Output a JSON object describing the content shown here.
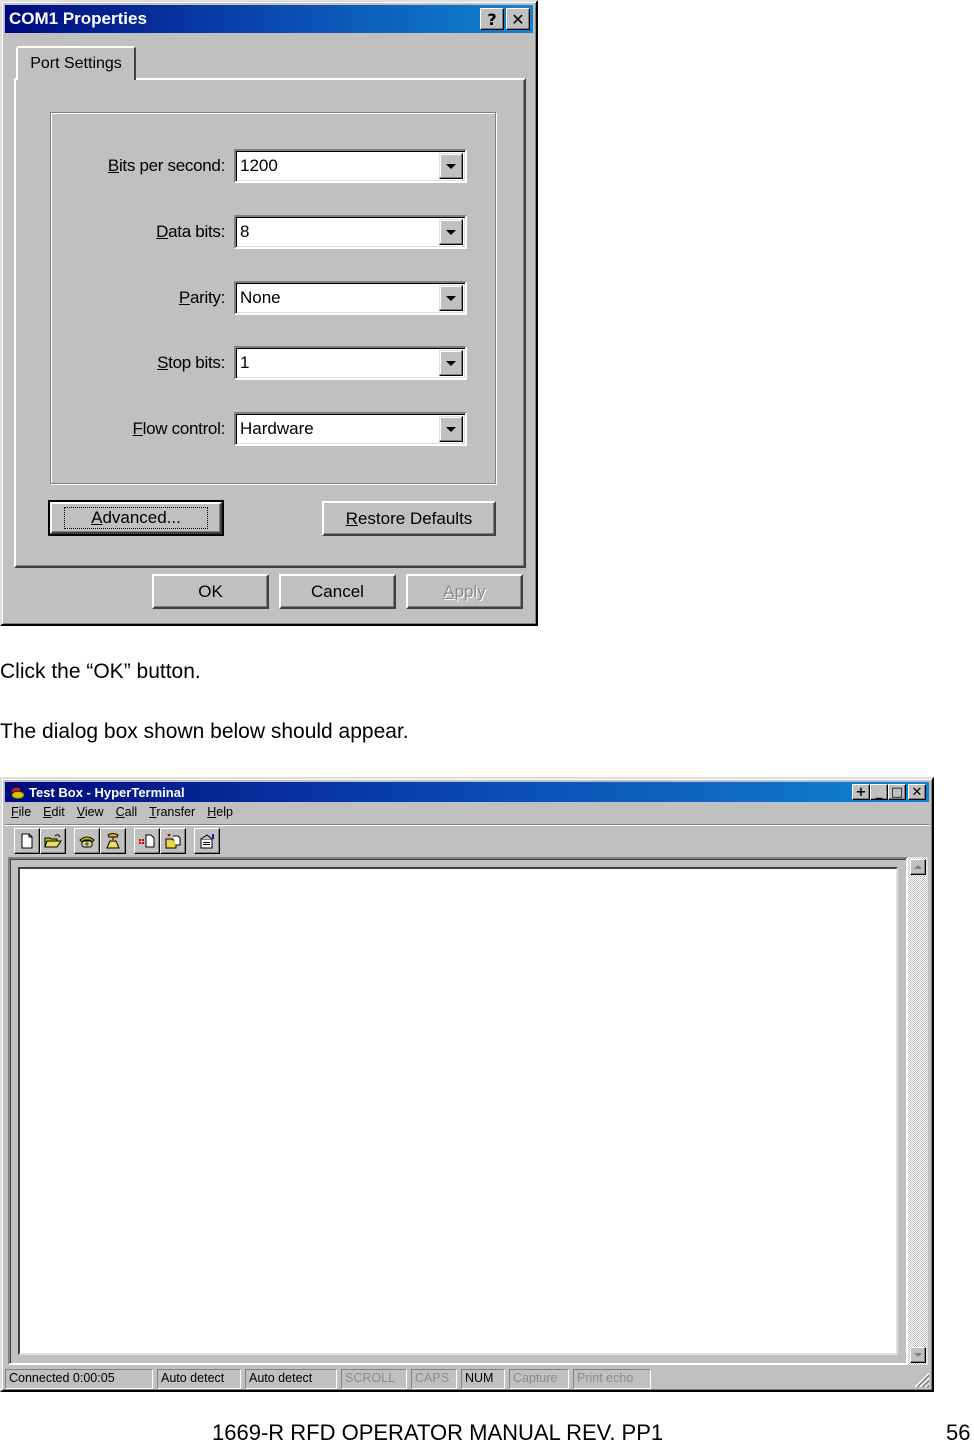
{
  "com1_dialog": {
    "title": "COM1 Properties",
    "help_button": "?",
    "close_button": "✕",
    "tab": "Port Settings",
    "fields": [
      {
        "label_mnemonic": "B",
        "label_rest": "its per second:",
        "value": "1200"
      },
      {
        "label_mnemonic": "D",
        "label_rest": "ata bits:",
        "value": "8"
      },
      {
        "label_mnemonic": "P",
        "label_rest": "arity:",
        "value": "None"
      },
      {
        "label_mnemonic": "S",
        "label_rest": "top bits:",
        "value": "1"
      },
      {
        "label_mnemonic": "F",
        "label_rest": "low control:",
        "value": "Hardware"
      }
    ],
    "advanced_button": {
      "mnemonic": "A",
      "rest": "dvanced..."
    },
    "restore_button": {
      "mnemonic": "R",
      "rest": "estore Defaults"
    },
    "ok_button": "OK",
    "cancel_button": "Cancel",
    "apply_button": {
      "mnemonic": "A",
      "rest": "pply"
    }
  },
  "instructions": {
    "step1": "Click the “OK” button.",
    "step2": "The dialog box shown below should appear."
  },
  "hyperterminal": {
    "title": "Test Box - HyperTerminal",
    "window_buttons": {
      "pin": "+",
      "minimize": "_",
      "maximize": "□",
      "close": "✕"
    },
    "menu": [
      {
        "mnemonic": "F",
        "rest": "ile"
      },
      {
        "mnemonic": "E",
        "rest": "dit"
      },
      {
        "mnemonic": "V",
        "rest": "iew"
      },
      {
        "mnemonic": "C",
        "rest": "all"
      },
      {
        "mnemonic": "T",
        "rest": "ransfer"
      },
      {
        "mnemonic": "H",
        "rest": "elp"
      }
    ],
    "toolbar": [
      "new-icon",
      "open-icon",
      "connect-icon",
      "disconnect-icon",
      "send-icon",
      "receive-icon",
      "properties-icon"
    ],
    "terminal_text": "",
    "status": {
      "connection": "Connected 0:00:05",
      "emulation": "Auto detect",
      "settings": "Auto detect",
      "scroll": "SCROLL",
      "caps": "CAPS",
      "num": "NUM",
      "capture": "Capture",
      "print_echo": "Print echo"
    }
  },
  "footer": {
    "manual": "1669-R RFD OPERATOR MANUAL REV. PP1",
    "page": "56"
  }
}
